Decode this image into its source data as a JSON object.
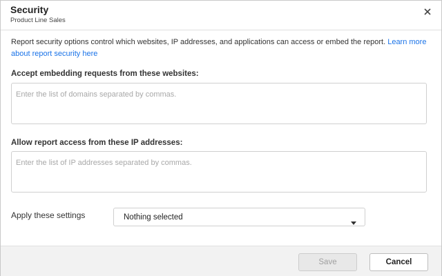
{
  "dialog": {
    "title": "Security",
    "subtitle": "Product Line Sales",
    "close_icon": "close-icon"
  },
  "description": {
    "text": "Report security options control which websites, IP addresses, and applications can access or embed the report. ",
    "link": "Learn more about report security here"
  },
  "websites": {
    "label": "Accept embedding requests from these websites:",
    "value": "",
    "placeholder": "Enter the list of domains separated by commas."
  },
  "ip_addresses": {
    "label": "Allow report access from these IP addresses:",
    "value": "",
    "placeholder": "Enter the list of IP addresses separated by commas."
  },
  "apply": {
    "label": "Apply these settings",
    "selected": "Nothing selected",
    "caret_icon": "caret-down-icon"
  },
  "footer": {
    "save_label": "Save",
    "cancel_label": "Cancel",
    "save_disabled": true
  }
}
